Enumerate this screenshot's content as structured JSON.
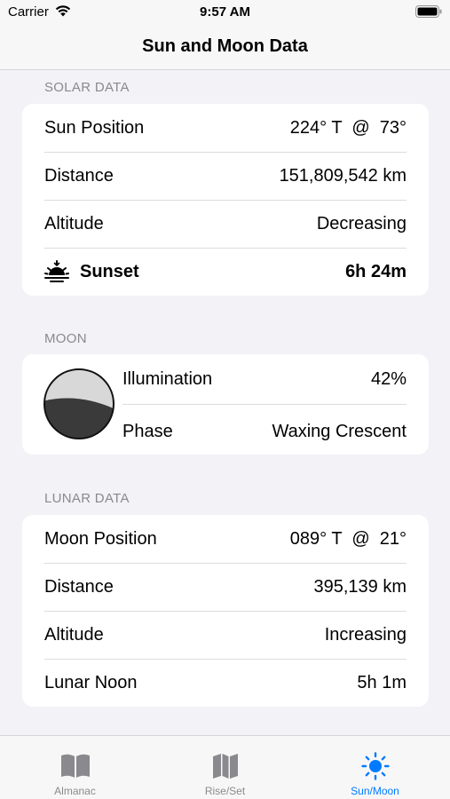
{
  "status_bar": {
    "carrier": "Carrier",
    "time": "9:57 AM"
  },
  "nav": {
    "title": "Sun and Moon Data"
  },
  "solar": {
    "header": "SOLAR DATA",
    "rows": [
      {
        "label": "Sun Position",
        "value": "224° T  @  73°"
      },
      {
        "label": "Distance",
        "value": "151,809,542 km"
      },
      {
        "label": "Altitude",
        "value": "Decreasing"
      },
      {
        "label": "Sunset",
        "value": "6h 24m",
        "icon": "sunset-icon"
      }
    ]
  },
  "moon": {
    "header": "MOON",
    "illumination_label": "Illumination",
    "illumination_value": "42%",
    "phase_label": "Phase",
    "phase_value": "Waxing Crescent"
  },
  "lunar": {
    "header": "LUNAR DATA",
    "rows": [
      {
        "label": "Moon Position",
        "value": "089° T  @  21°"
      },
      {
        "label": "Distance",
        "value": "395,139 km"
      },
      {
        "label": "Altitude",
        "value": "Increasing"
      },
      {
        "label": "Lunar Noon",
        "value": "5h 1m"
      }
    ]
  },
  "tabs": [
    {
      "label": "Almanac",
      "icon": "book-icon",
      "active": false
    },
    {
      "label": "Rise/Set",
      "icon": "map-icon",
      "active": false
    },
    {
      "label": "Sun/Moon",
      "icon": "sun-icon",
      "active": true
    }
  ],
  "colors": {
    "accent": "#007aff",
    "background": "#f2f2f7",
    "secondary_text": "#8a8a8e"
  }
}
